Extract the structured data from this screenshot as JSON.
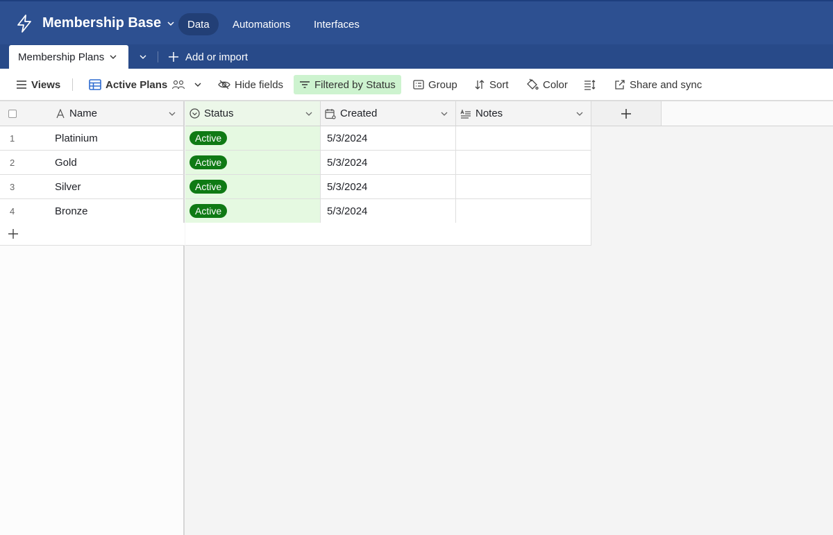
{
  "app": {
    "base_title": "Membership Base",
    "nav": [
      {
        "label": "Data",
        "active": true
      },
      {
        "label": "Automations",
        "active": false
      },
      {
        "label": "Interfaces",
        "active": false
      }
    ],
    "brand_color": "#2d5091"
  },
  "tables": {
    "active_tab": "Membership Plans",
    "add_import_label": "Add or import"
  },
  "toolbar": {
    "views_label": "Views",
    "view_name": "Active Plans",
    "hide_fields_label": "Hide fields",
    "filter_label": "Filtered by Status",
    "group_label": "Group",
    "sort_label": "Sort",
    "color_label": "Color",
    "share_label": "Share and sync"
  },
  "grid": {
    "columns": [
      {
        "name": "Name",
        "icon": "text-field-icon"
      },
      {
        "name": "Status",
        "icon": "single-select-icon"
      },
      {
        "name": "Created",
        "icon": "created-time-icon"
      },
      {
        "name": "Notes",
        "icon": "long-text-icon"
      }
    ],
    "rows": [
      {
        "num": "1",
        "name": "Platinium",
        "status": "Active",
        "created": "5/3/2024",
        "notes": ""
      },
      {
        "num": "2",
        "name": "Gold",
        "status": "Active",
        "created": "5/3/2024",
        "notes": ""
      },
      {
        "num": "3",
        "name": "Silver",
        "status": "Active",
        "created": "5/3/2024",
        "notes": ""
      },
      {
        "num": "4",
        "name": "Bronze",
        "status": "Active",
        "created": "5/3/2024",
        "notes": ""
      }
    ],
    "status_color": "#0f7a14",
    "status_cell_bg": "#e5f9e1"
  }
}
